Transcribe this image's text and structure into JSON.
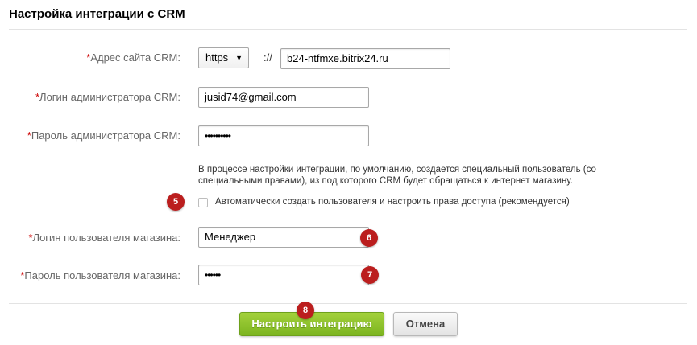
{
  "page": {
    "title": "Настройка интеграции с CRM"
  },
  "form": {
    "required_mark": "*",
    "crm_address": {
      "label": "Адрес сайта CRM:",
      "protocol": "https",
      "separator": "://",
      "value": "b24-ntfmxe.bitrix24.ru"
    },
    "admin_login": {
      "label": "Логин администратора CRM:",
      "value": "jusid74@gmail.com"
    },
    "admin_password": {
      "label": "Пароль администратора CRM:",
      "value": "••••••••••"
    },
    "note": "В процессе настройки интеграции, по умолчанию, создается специальный пользователь (со специальными правами), из под которого CRM будет обращаться к интернет магазину.",
    "auto_create": {
      "label": "Автоматически создать пользователя и настроить права доступа (рекомендуется)",
      "checked": false
    },
    "shop_login": {
      "label": "Логин пользователя магазина:",
      "value": "Менеджер"
    },
    "shop_password": {
      "label": "Пароль пользователя магазина:",
      "value": "••••••"
    }
  },
  "badges": {
    "b5": "5",
    "b6": "6",
    "b7": "7",
    "b8": "8"
  },
  "buttons": {
    "submit": "Настроить интеграцию",
    "cancel": "Отмена"
  },
  "colors": {
    "badge": "#bb1e1e",
    "primary": "#8cc231",
    "required": "#cc0000"
  }
}
